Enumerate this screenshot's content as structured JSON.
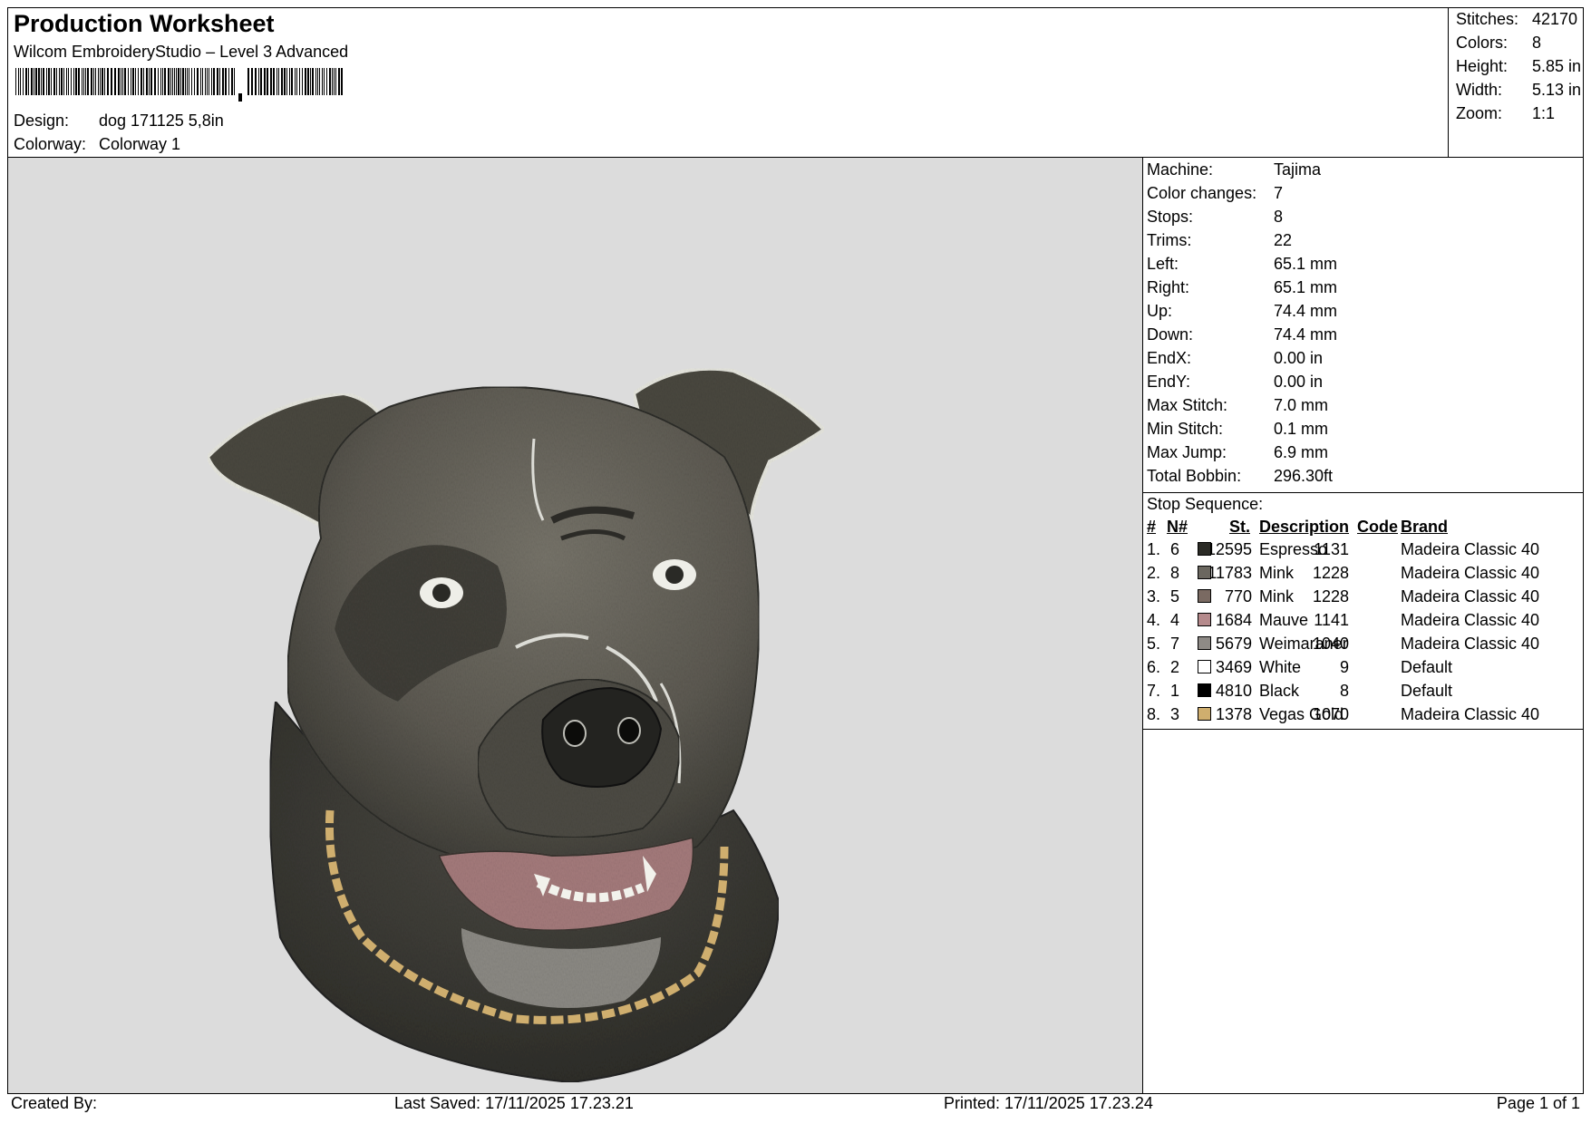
{
  "header": {
    "title": "Production Worksheet",
    "software": "Wilcom EmbroideryStudio – Level 3 Advanced",
    "design_label": "Design:",
    "design_value": "dog 171125 5,8in",
    "colorway_label": "Colorway:",
    "colorway_value": "Colorway 1"
  },
  "stats": [
    {
      "label": "Stitches:",
      "value": "42170"
    },
    {
      "label": "Colors:",
      "value": "8"
    },
    {
      "label": "Height:",
      "value": "5.85 in"
    },
    {
      "label": "Width:",
      "value": "5.13 in"
    },
    {
      "label": "Zoom:",
      "value": "1:1"
    }
  ],
  "machine_info": [
    {
      "label": "Machine:",
      "value": "Tajima"
    },
    {
      "label": "Color changes:",
      "value": "7"
    },
    {
      "label": "Stops:",
      "value": "8"
    },
    {
      "label": "Trims:",
      "value": "22"
    },
    {
      "label": "Left:",
      "value": "65.1 mm"
    },
    {
      "label": "Right:",
      "value": "65.1 mm"
    },
    {
      "label": "Up:",
      "value": "74.4 mm"
    },
    {
      "label": "Down:",
      "value": "74.4 mm"
    },
    {
      "label": "EndX:",
      "value": "0.00 in"
    },
    {
      "label": "EndY:",
      "value": "0.00 in"
    },
    {
      "label": "Max Stitch:",
      "value": "7.0 mm"
    },
    {
      "label": "Min Stitch:",
      "value": "0.1 mm"
    },
    {
      "label": "Max Jump:",
      "value": "6.9 mm"
    },
    {
      "label": "Total Bobbin:",
      "value": "296.30ft"
    }
  ],
  "stop_sequence": {
    "caption": "Stop Sequence:",
    "headers": {
      "num": "#",
      "needle": "N#",
      "stitches": "St.",
      "description": "Description",
      "code": "Code",
      "brand": "Brand"
    },
    "rows": [
      {
        "num": "1.",
        "needle": "6",
        "stitches": "12595",
        "description": "Espresso",
        "code": "1131",
        "brand": "Madeira Classic 40",
        "color": "#2b2b26"
      },
      {
        "num": "2.",
        "needle": "8",
        "stitches": "11783",
        "description": "Mink",
        "code": "1228",
        "brand": "Madeira Classic 40",
        "color": "#6b675f"
      },
      {
        "num": "3.",
        "needle": "5",
        "stitches": "770",
        "description": "Mink",
        "code": "1228",
        "brand": "Madeira Classic 40",
        "color": "#7a6a62"
      },
      {
        "num": "4.",
        "needle": "4",
        "stitches": "1684",
        "description": "Mauve",
        "code": "1141",
        "brand": "Madeira Classic 40",
        "color": "#b58a8c"
      },
      {
        "num": "5.",
        "needle": "7",
        "stitches": "5679",
        "description": "Weimaraner",
        "code": "1040",
        "brand": "Madeira Classic 40",
        "color": "#8e8a86"
      },
      {
        "num": "6.",
        "needle": "2",
        "stitches": "3469",
        "description": "White",
        "code": "9",
        "brand": "Default",
        "color": "#ffffff"
      },
      {
        "num": "7.",
        "needle": "1",
        "stitches": "4810",
        "description": "Black",
        "code": "8",
        "brand": "Default",
        "color": "#000000"
      },
      {
        "num": "8.",
        "needle": "3",
        "stitches": "1378",
        "description": "Vegas Gold",
        "code": "1070",
        "brand": "Madeira Classic 40",
        "color": "#cfae6e"
      }
    ]
  },
  "footer": {
    "created_by": "Created By:",
    "last_saved": "Last Saved: 17/11/2025 17.23.21",
    "printed": "Printed: 17/11/2025 17.23.24",
    "page": "Page 1 of 1"
  },
  "icons": {
    "barcode": "barcode-icon",
    "design_preview": "dog-head-embroidery"
  }
}
